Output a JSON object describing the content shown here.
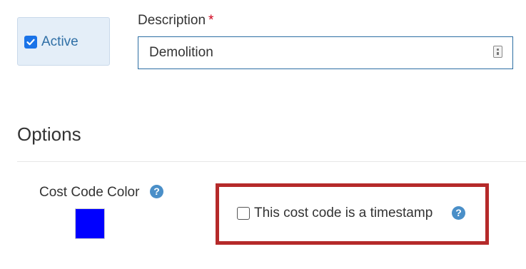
{
  "active": {
    "label": "Active",
    "checked": true
  },
  "description": {
    "label": "Description",
    "required_marker": "*",
    "value": "Demolition",
    "field_icon": "clipboard-icon"
  },
  "options": {
    "title": "Options",
    "cost_code_color": {
      "label": "Cost Code Color",
      "help_icon_glyph": "?",
      "swatch_color": "#0000ff"
    },
    "timestamp": {
      "label": "This cost code is a timestamp",
      "checked": false,
      "help_icon_glyph": "?",
      "highlight_color": "#b52a2a"
    }
  },
  "colors": {
    "accent": "#1a73e8",
    "help_icon": "#4a8fc8",
    "active_box_bg": "#e4eef8",
    "input_border": "#2c6ea3",
    "required": "#d0021b"
  }
}
